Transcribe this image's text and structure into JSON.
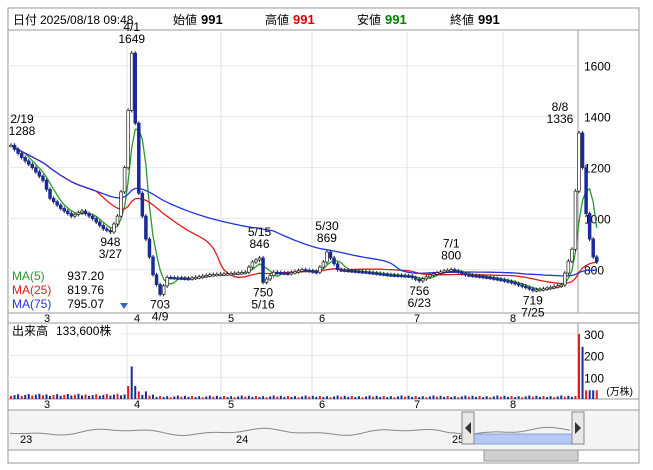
{
  "header": {
    "date_label": "日付",
    "date_value": "2025/08/18 09:48",
    "open_label": "始値",
    "open_value": "991",
    "high_label": "高値",
    "high_value": "991",
    "low_label": "安値",
    "low_value": "991",
    "close_label": "終値",
    "close_value": "991",
    "high_color": "#e00000",
    "low_color": "#008000"
  },
  "chart_data": {
    "type": "candlestick",
    "x_tick_labels": [
      "3",
      "4",
      "5",
      "6",
      "7",
      "8"
    ],
    "y_ticks": [
      800,
      1000,
      1200,
      1400,
      1600
    ],
    "ylim": [
      630,
      1740
    ],
    "volume_ticks": [
      100,
      200,
      300
    ],
    "volume_ylim": [
      0,
      350
    ],
    "volume_unit": "(万株)",
    "volume_label": "出来高",
    "volume_value": "133,600株",
    "moving_averages": [
      {
        "name": "MA(5)",
        "value": "937.20",
        "color": "#2a9a2a"
      },
      {
        "name": "MA(25)",
        "value": "819.76",
        "color": "#e01b1b"
      },
      {
        "name": "MA(75)",
        "value": "795.07",
        "color": "#2233dd"
      }
    ],
    "annotations": [
      {
        "lines": [
          "2/19",
          "1288"
        ],
        "date": "2/19",
        "value": 1288,
        "kind": "high"
      },
      {
        "lines": [
          "4/1",
          "1649"
        ],
        "date": "4/1",
        "value": 1649,
        "kind": "high"
      },
      {
        "lines": [
          "948",
          "3/27"
        ],
        "date": "3/27",
        "value": 948,
        "kind": "low"
      },
      {
        "lines": [
          "703",
          "4/9"
        ],
        "date": "4/9",
        "value": 703,
        "kind": "low"
      },
      {
        "lines": [
          "5/15",
          "846"
        ],
        "date": "5/15",
        "value": 846,
        "kind": "high"
      },
      {
        "lines": [
          "750",
          "5/16"
        ],
        "date": "5/16",
        "value": 750,
        "kind": "low"
      },
      {
        "lines": [
          "5/30",
          "869"
        ],
        "date": "5/30",
        "value": 869,
        "kind": "high"
      },
      {
        "lines": [
          "756",
          "6/23"
        ],
        "date": "6/23",
        "value": 756,
        "kind": "low"
      },
      {
        "lines": [
          "7/1",
          "800"
        ],
        "date": "7/1",
        "value": 800,
        "kind": "high"
      },
      {
        "lines": [
          "719",
          "7/25"
        ],
        "date": "7/25",
        "value": 719,
        "kind": "low"
      },
      {
        "lines": [
          "8/8",
          "1336"
        ],
        "date": "8/8",
        "value": 1336,
        "kind": "high"
      }
    ],
    "overview_labels": [
      "23",
      "24",
      "25"
    ]
  }
}
